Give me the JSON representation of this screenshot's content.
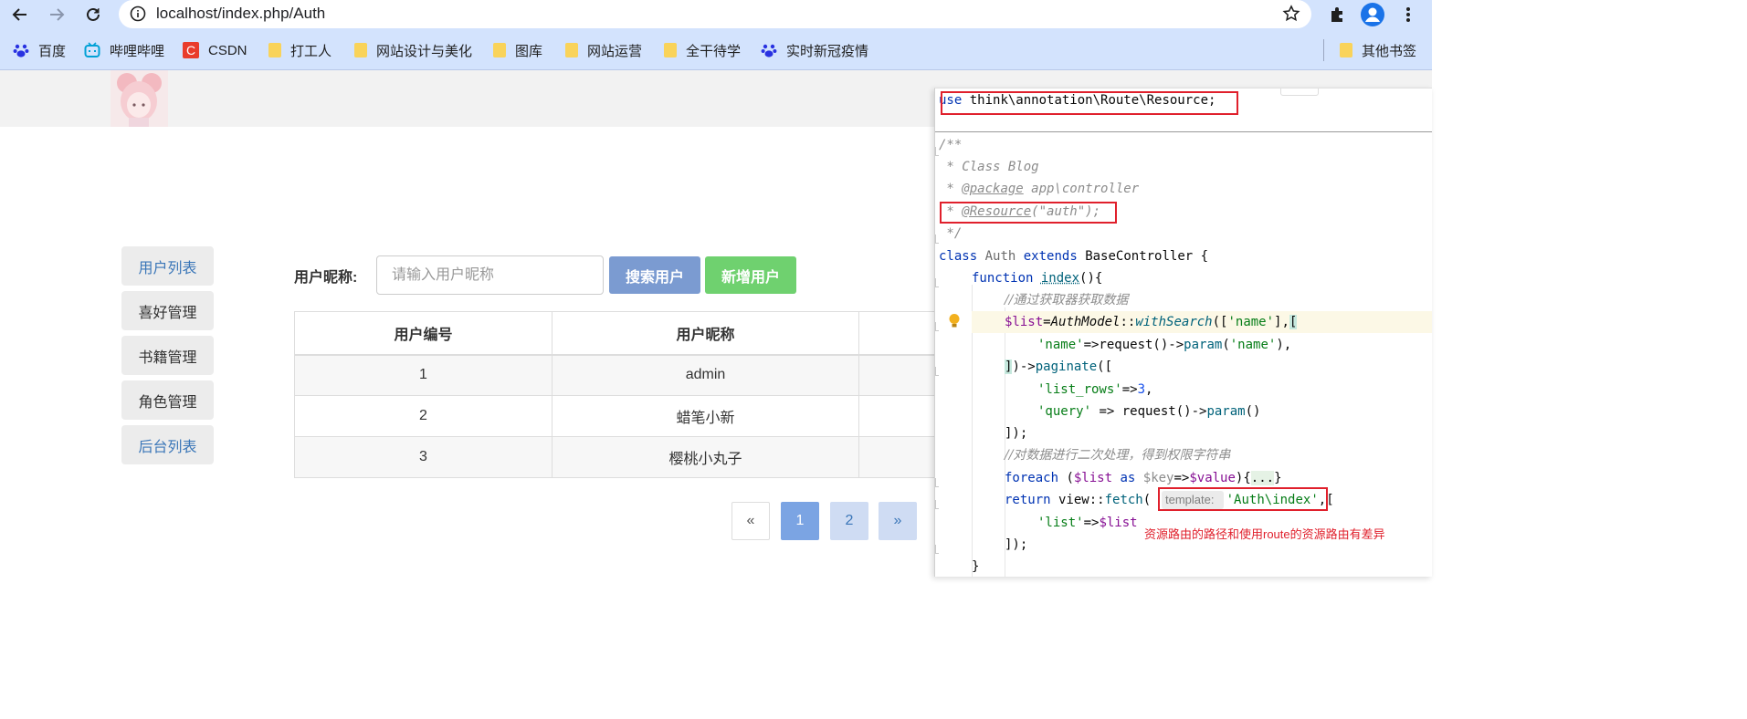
{
  "browser": {
    "url": "localhost/index.php/Auth",
    "bookmarks": [
      {
        "label": "百度",
        "icon": "baidu-paw-icon"
      },
      {
        "label": "哔哩哔哩",
        "icon": "bilibili-tv-icon"
      },
      {
        "label": "CSDN",
        "icon": "csdn-c-icon"
      },
      {
        "label": "打工人",
        "icon": "folder-icon"
      },
      {
        "label": "网站设计与美化",
        "icon": "folder-icon"
      },
      {
        "label": "图库",
        "icon": "folder-icon"
      },
      {
        "label": "网站运营",
        "icon": "folder-icon"
      },
      {
        "label": "全干待学",
        "icon": "folder-icon"
      },
      {
        "label": "实时新冠疫情",
        "icon": "baidu-paw-icon"
      }
    ],
    "other_bookmarks": "其他书签"
  },
  "sidebar": {
    "items": [
      {
        "label": "用户列表",
        "color": "#3a76b8"
      },
      {
        "label": "喜好管理",
        "color": "#333333"
      },
      {
        "label": "书籍管理",
        "color": "#333333"
      },
      {
        "label": "角色管理",
        "color": "#333333"
      },
      {
        "label": "后台列表",
        "color": "#3a76b8"
      }
    ]
  },
  "search": {
    "label": "用户昵称:",
    "placeholder": "请输入用户昵称",
    "search_button": "搜索用户",
    "add_button": "新增用户",
    "search_color": "#7b9bd1",
    "add_color": "#6fd16f"
  },
  "table": {
    "headers": [
      "用户编号",
      "用户昵称"
    ],
    "rows": [
      [
        "1",
        "admin"
      ],
      [
        "2",
        "蜡笔小新"
      ],
      [
        "3",
        "樱桃小丸子"
      ]
    ]
  },
  "pagination": {
    "prev": "«",
    "pages": [
      "1",
      "2"
    ],
    "active": "1",
    "next": "»"
  },
  "code": {
    "hint_label": "template:",
    "annotation": "资源路由的路径和使用route的资源路由有差异"
  }
}
